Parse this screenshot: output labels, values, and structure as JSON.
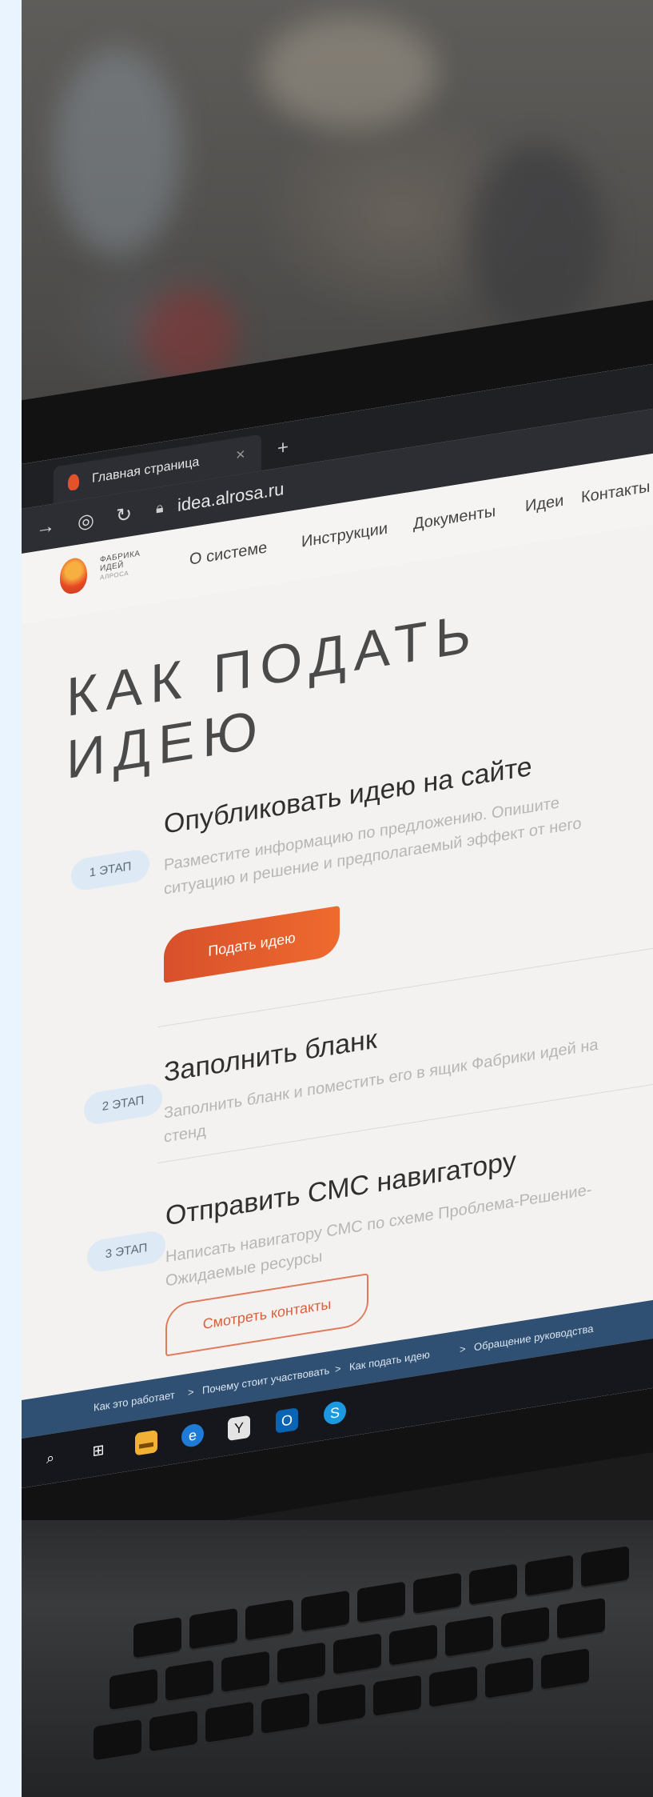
{
  "browser": {
    "tab_title": "Главная страница",
    "tab_close": "×",
    "new_tab": "+",
    "url": "idea.alrosa.ru"
  },
  "site": {
    "logo": {
      "line1": "ФАБРИКА",
      "line2": "ИДЕЙ",
      "line3": "АЛРОСА"
    },
    "nav": [
      "О системе",
      "Инструкции",
      "Документы",
      "Идеи",
      "Контакты"
    ],
    "page_title": "КАК ПОДАТЬ ИДЕЮ",
    "steps": [
      {
        "badge": "1 ЭТАП",
        "title": "Опубликовать идею на сайте",
        "desc": "Разместите информацию по предложению. Опишите ситуацию и решение и предполагаемый эффект от него",
        "button": "Подать идею"
      },
      {
        "badge": "2 ЭТАП",
        "title": "Заполнить бланк",
        "desc": "Заполнить бланк и поместить его в ящик Фабрики идей на стенд"
      },
      {
        "badge": "3 ЭТАП",
        "title": "Отправить СМС навигатору",
        "desc": "Написать навигатору СМС по схеме Проблема-Решение-Ожидаемые ресурсы",
        "button": "Смотреть контакты"
      }
    ],
    "breadcrumb": [
      "Как это работает",
      "Почему стоит участвовать",
      "Как подать идею",
      "Обращение руководства"
    ],
    "breadcrumb_sep": ">"
  },
  "taskbar": {
    "icons": [
      "search-icon",
      "task-view-icon",
      "file-explorer-icon",
      "edge-icon",
      "yandex-icon",
      "outlook-icon",
      "skype-icon"
    ],
    "labels": [
      "⌕",
      "⊞",
      "▬",
      "e",
      "Y",
      "O",
      "S"
    ],
    "colors": [
      "#15171c",
      "#15171c",
      "#f2b134",
      "#1e7bd6",
      "#e4e4e4",
      "#0a64b3",
      "#1c98e0"
    ]
  }
}
